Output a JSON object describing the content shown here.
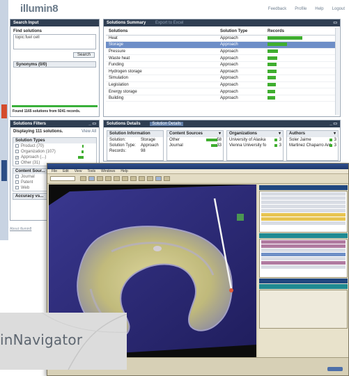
{
  "illumin8": {
    "logo": "illumin8",
    "nav": [
      "Feedback",
      "Profile",
      "Help",
      "Logout"
    ],
    "search": {
      "header": "Search Input",
      "find_label": "Find solutions",
      "query": "topic:fuel cell",
      "search_button": "Search",
      "synonyms": "Synonyms (0/0)",
      "found": "Found 1165 solutions from 9241 records."
    },
    "summary": {
      "header": "Solutions Summary",
      "export": "Export to Excel",
      "columns": [
        "Solutions",
        "Solution Type",
        "Records"
      ],
      "rows": [
        {
          "name": "Heat",
          "type": "Approach",
          "records": 1.0
        },
        {
          "name": "Storage",
          "type": "Approach",
          "records": 0.55
        },
        {
          "name": "Pressure",
          "type": "Approach",
          "records": 0.3
        },
        {
          "name": "Waste heat",
          "type": "Approach",
          "records": 0.28
        },
        {
          "name": "Funding",
          "type": "Approach",
          "records": 0.26
        },
        {
          "name": "Hydrogen storage",
          "type": "Approach",
          "records": 0.25
        },
        {
          "name": "Simulation",
          "type": "Approach",
          "records": 0.24
        },
        {
          "name": "Legislation",
          "type": "Approach",
          "records": 0.23
        },
        {
          "name": "Energy storage",
          "type": "Approach",
          "records": 0.22
        },
        {
          "name": "Building",
          "type": "Approach",
          "records": 0.21
        }
      ],
      "selected_row": 1
    },
    "filters": {
      "header": "Solutions Filters",
      "displaying": "Displaying 111 solutions.",
      "view_all": "View All",
      "groups": [
        {
          "title": "Solution Types",
          "items": [
            {
              "label": "Product (70)",
              "checked": false,
              "level": 0.25
            },
            {
              "label": "Organization (107)",
              "checked": false,
              "level": 0.35
            },
            {
              "label": "Approach (...)",
              "checked": true,
              "level": 1.0
            },
            {
              "label": "Other (31)",
              "checked": false,
              "level": 0.0
            }
          ]
        },
        {
          "title": "Content Sour...",
          "items": [
            {
              "label": "Journal",
              "checked": false,
              "level": 0.0
            },
            {
              "label": "Patent",
              "checked": false,
              "level": 0.0
            },
            {
              "label": "Web",
              "checked": false,
              "level": 0.0
            }
          ]
        },
        {
          "title": "Accuracy vs...",
          "items": []
        }
      ],
      "about": "About illumin8"
    },
    "details": {
      "header": "Solutions Details",
      "tab": "Solution Details",
      "info": {
        "title": "Solution Information",
        "rows": [
          {
            "k": "Solution:",
            "v": "Storage"
          },
          {
            "k": "Solution Type:",
            "v": "Approach"
          },
          {
            "k": "Records:",
            "v": "98"
          }
        ]
      },
      "sources": {
        "title": "Content Sources",
        "rows": [
          {
            "k": "Other",
            "v": "58"
          },
          {
            "k": "Journal",
            "v": "33"
          }
        ]
      },
      "orgs": {
        "title": "Organizations",
        "rows": [
          {
            "k": "University of Alaska",
            "v": "3"
          },
          {
            "k": "Vienna University fo",
            "v": "3"
          }
        ]
      },
      "authors": {
        "title": "Authors",
        "rows": [
          {
            "k": "Soler Jaime",
            "v": "3"
          },
          {
            "k": "Martinez Chaparro Ant",
            "v": "3"
          }
        ]
      }
    }
  },
  "brainnavigator": {
    "brand": "inNavigator",
    "menu": [
      "File",
      "Edit",
      "View",
      "Tools",
      "Windows",
      "Help"
    ]
  },
  "colors": {
    "panel_header": "#2f3e52",
    "bar_green": "#3fae2f",
    "selection": "#6d8ec7",
    "brain_bg": "#2c2a78"
  }
}
